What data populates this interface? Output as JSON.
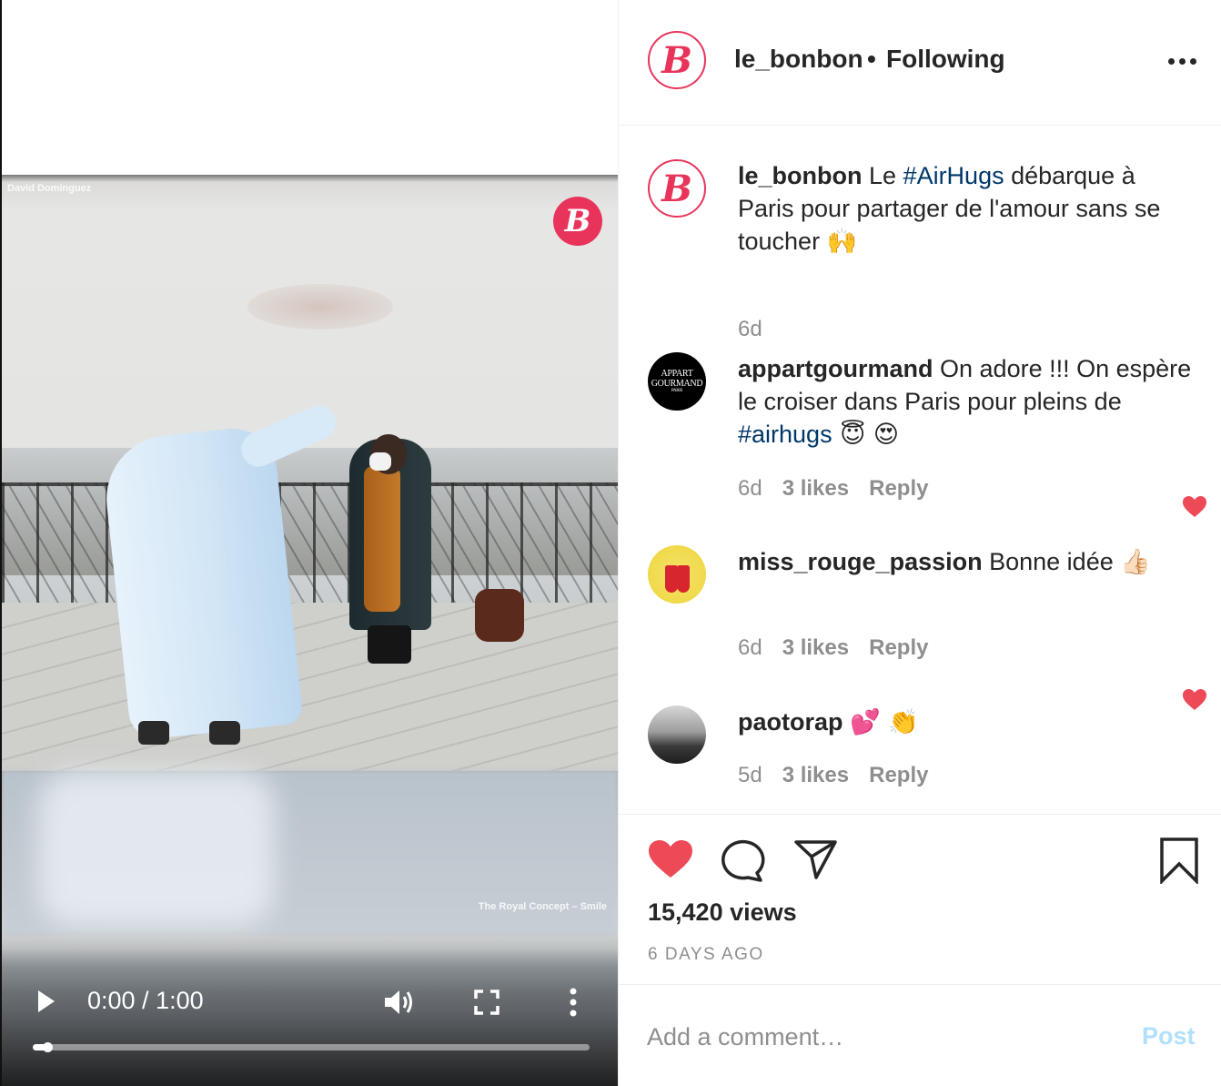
{
  "video": {
    "credit_watermark": "David Dominguez",
    "music_watermark": "The Royal Concept – Smile",
    "brand_badge": "B",
    "time_display": "0:00 / 1:00",
    "progress": 0.02
  },
  "header": {
    "avatar_letter": "B",
    "username": "le_bonbon",
    "separator": "•",
    "follow_status": "Following"
  },
  "caption": {
    "avatar_letter": "B",
    "username": "le_bonbon",
    "text_before": " Le ",
    "hashtag": "#AirHugs",
    "text_after": " débarque à Paris pour partager de l'amour sans se toucher ",
    "emoji": "🙌",
    "time": "6d"
  },
  "comments": [
    {
      "avatar_text": [
        "APPART",
        "GOURMAND",
        "PARIS"
      ],
      "username": "appartgourmand",
      "text_before": " On adore !!! On espère le croiser dans Paris pour pleins de ",
      "hashtag": "#airhugs",
      "emoji": " 😇 😍",
      "time": "6d",
      "likes": "3 likes",
      "reply": "Reply"
    },
    {
      "username": "miss_rouge_passion",
      "text_before": " Bonne idée ",
      "emoji": "👍🏻",
      "time": "6d",
      "likes": "3 likes",
      "reply": "Reply"
    },
    {
      "username": "paotorap",
      "text_before": " ",
      "emoji": "💕 👏",
      "time": "5d",
      "likes": "3 likes",
      "reply": "Reply"
    }
  ],
  "actions": {
    "views": "15,420 views",
    "posted_ago": "6 DAYS AGO",
    "liked": true,
    "like_color": "#ed4956"
  },
  "add_comment": {
    "placeholder": "Add a comment…",
    "post_label": "Post"
  },
  "colors": {
    "brand": "#e8345a",
    "hashtag": "#00376b",
    "muted": "#8e8e8e",
    "post_disabled": "#b2dffc"
  },
  "icons": [
    "play-icon",
    "volume-icon",
    "fullscreen-icon",
    "more-vertical-icon",
    "more-horizontal-icon",
    "heart-icon",
    "comment-icon",
    "share-icon",
    "bookmark-icon"
  ]
}
